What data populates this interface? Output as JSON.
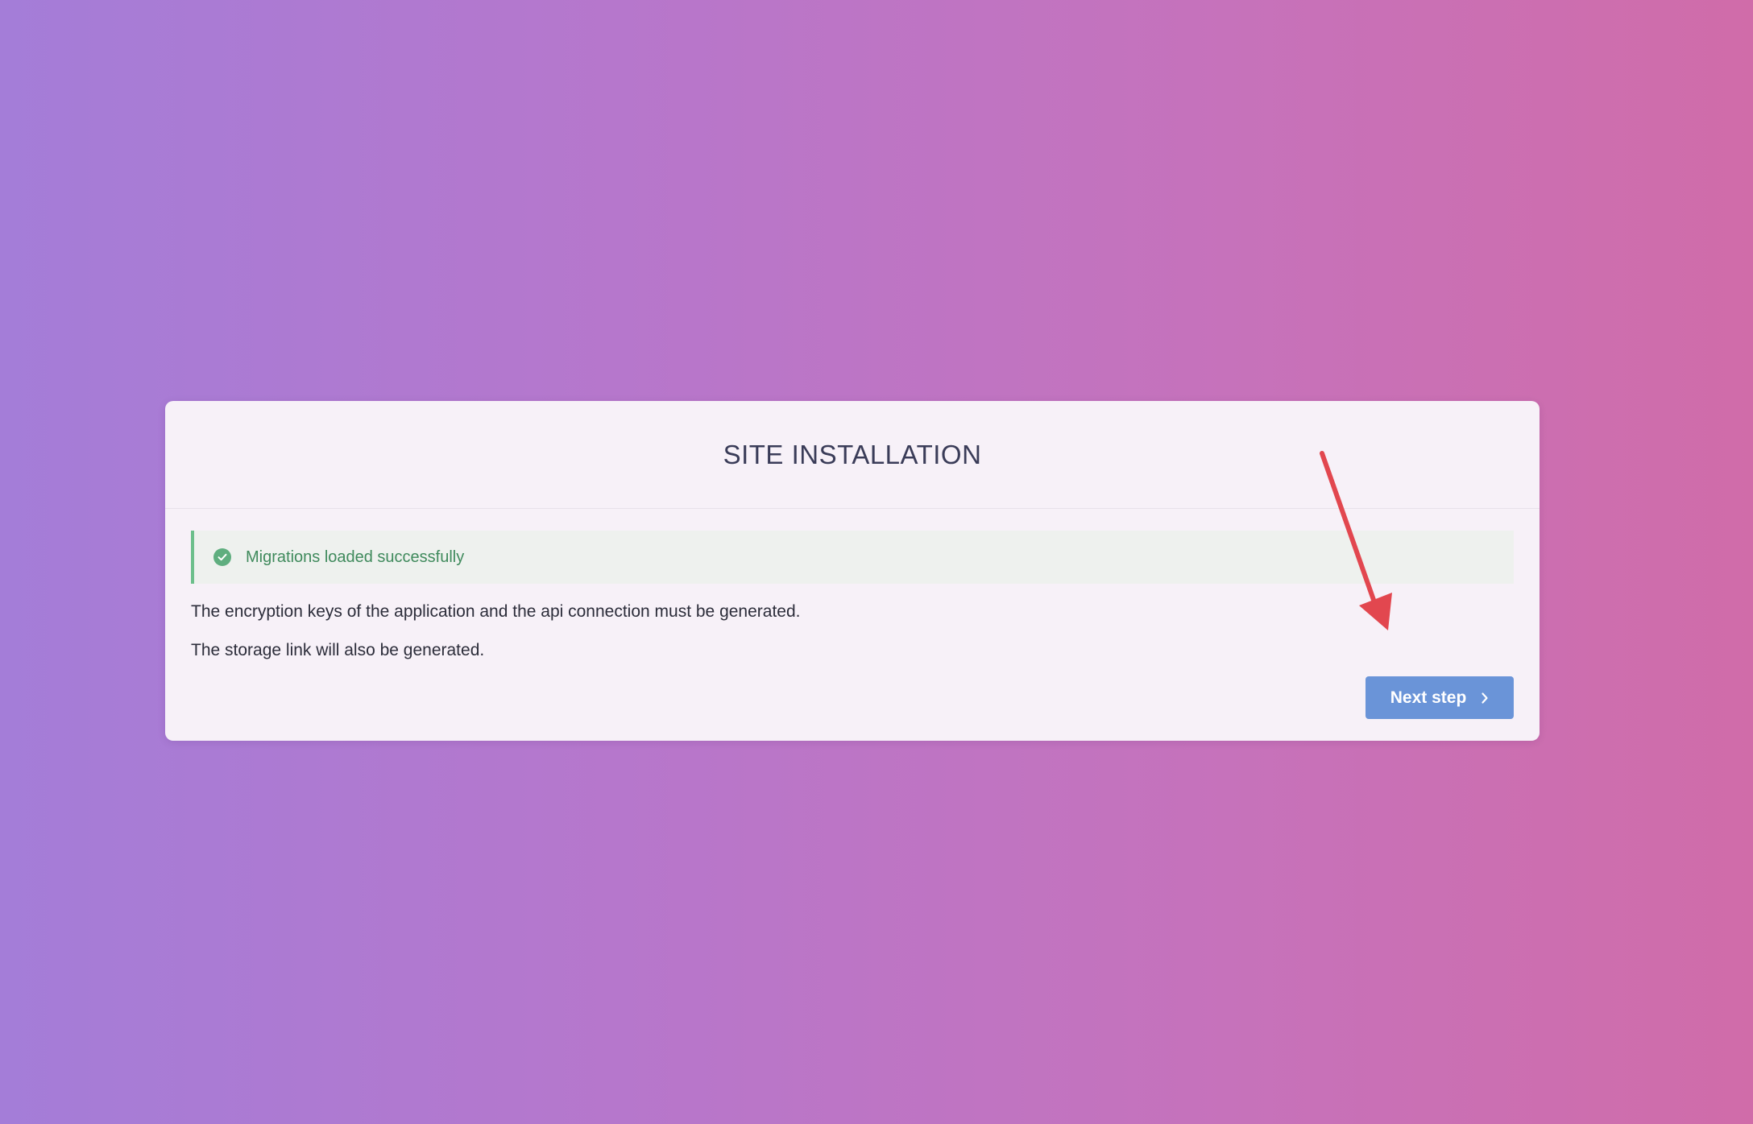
{
  "installer": {
    "title": "SITE INSTALLATION",
    "alert": {
      "message": "Migrations loaded successfully",
      "icon": "check-circle-icon",
      "color": "#5fae7f"
    },
    "paragraphs": [
      "The encryption keys of the application and the api connection must be generated.",
      "The storage link will also be generated."
    ],
    "next_button": {
      "label": "Next step",
      "icon": "chevron-right-icon",
      "color": "#6a94d8"
    }
  },
  "annotation": {
    "type": "arrow",
    "color": "#e2474f"
  }
}
